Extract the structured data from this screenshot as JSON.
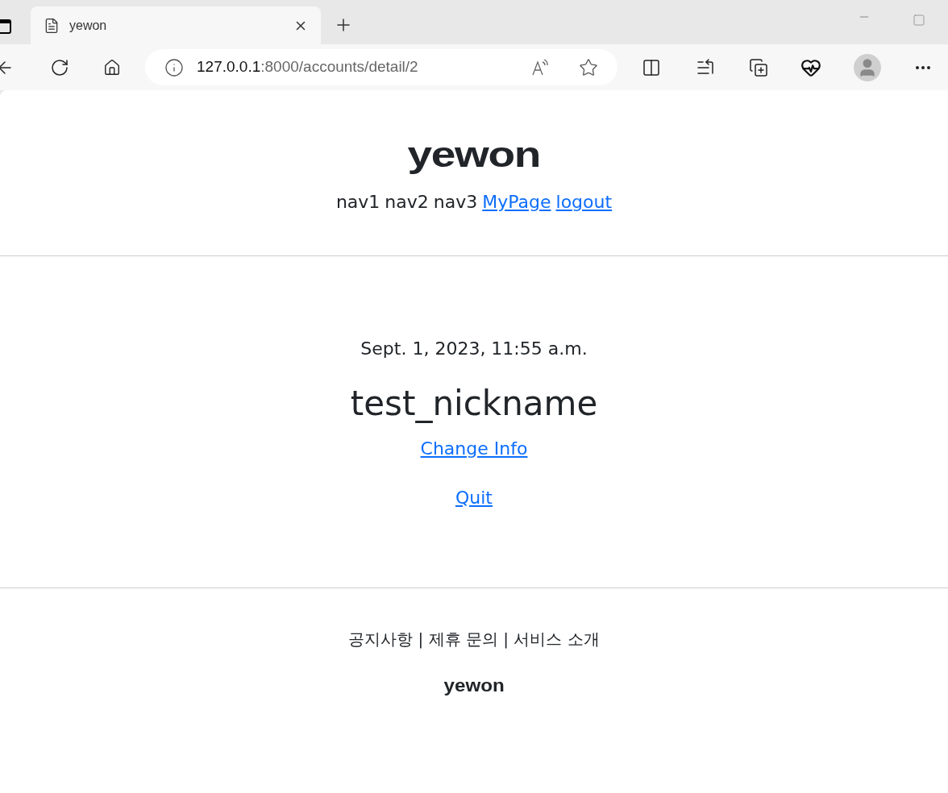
{
  "browser": {
    "tab": {
      "title": "yewon",
      "selected": true
    },
    "url": {
      "host": "127.0.0.1",
      "path": ":8000/accounts/detail/2"
    }
  },
  "header": {
    "logo": "yewon",
    "nav": [
      {
        "label": "nav1",
        "kind": "text"
      },
      {
        "label": "nav2",
        "kind": "text"
      },
      {
        "label": "nav3",
        "kind": "text"
      },
      {
        "label": "MyPage",
        "kind": "link"
      },
      {
        "label": "logout",
        "kind": "link"
      }
    ]
  },
  "profile": {
    "date": "Sept. 1, 2023, 11:55 a.m.",
    "nickname": "test_nickname",
    "links": [
      "Change Info",
      "Quit"
    ]
  },
  "footer": {
    "links": "공지사항 | 제휴 문의 | 서비스 소개",
    "logo": "yewon"
  }
}
